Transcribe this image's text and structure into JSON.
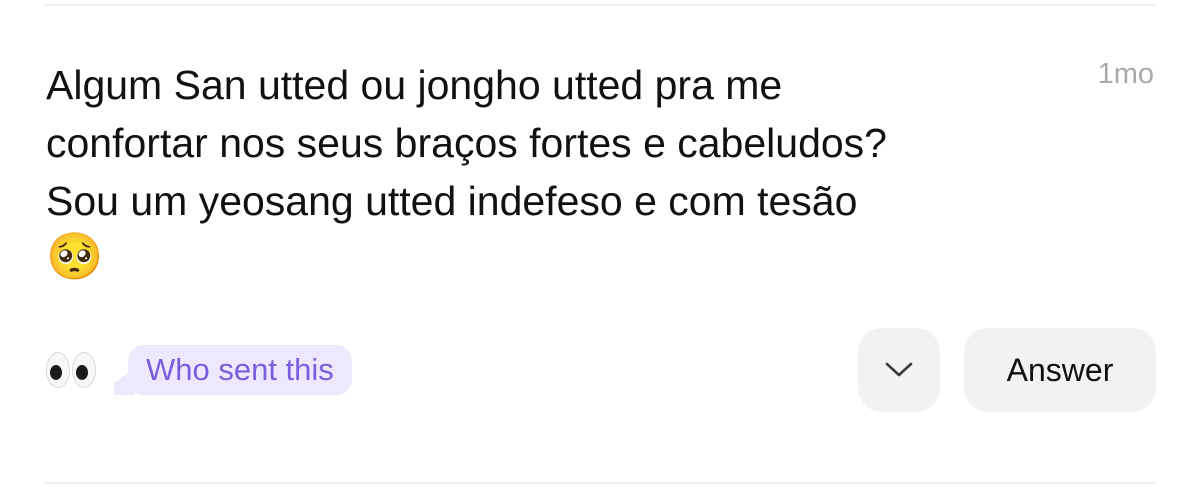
{
  "question": {
    "text": "Algum San utted ou jongho utted pra me\nconfortar nos seus braços fortes e cabeludos?\nSou um yeosang utted indefeso e com tesão",
    "emoji": "🥺",
    "emoji_name": "pleading-face",
    "time": "1mo"
  },
  "footer": {
    "eyes_icon": "eyes-emoji",
    "who_sent_label": "Who sent this",
    "more_icon": "chevron-down",
    "answer_label": "Answer"
  },
  "colors": {
    "accent_purple": "#7b5ee0",
    "bubble_bg": "#ede8fd",
    "button_bg": "#f2f2f4",
    "timestamp": "#a9a9ae"
  }
}
